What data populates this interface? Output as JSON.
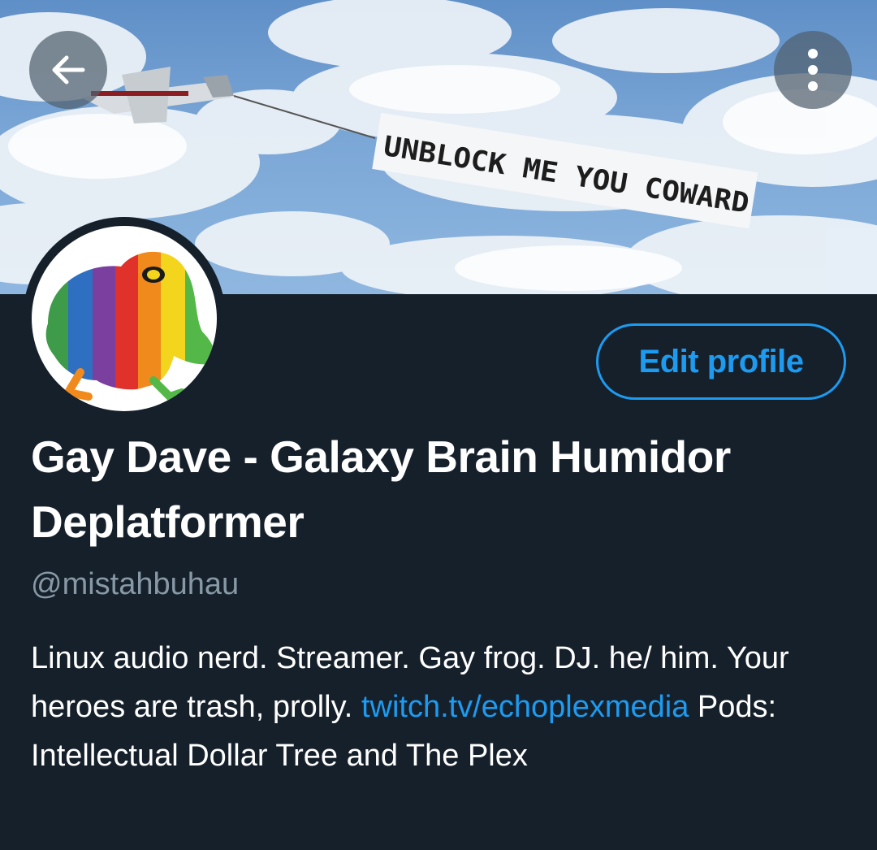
{
  "banner": {
    "sign_text": "UNBLOCK ME YOU COWARD"
  },
  "header": {
    "back_icon": "arrow-left-icon",
    "more_icon": "more-vertical-icon"
  },
  "profile": {
    "edit_label": "Edit profile",
    "display_name": "Gay Dave - Galaxy Brain Humidor Deplatformer",
    "handle": "@mistahbuhau",
    "bio": {
      "part1": "Linux audio nerd. Streamer. Gay frog. DJ. he/ him.  Your heroes are trash, prolly.  ",
      "link1": "twitch.tv/echoplexmedia",
      "part2": "  Pods: Intellectual Dollar Tree and The Plex"
    }
  },
  "colors": {
    "background": "#15202b",
    "accent": "#1d9bf0",
    "secondary_text": "#8899a6"
  }
}
